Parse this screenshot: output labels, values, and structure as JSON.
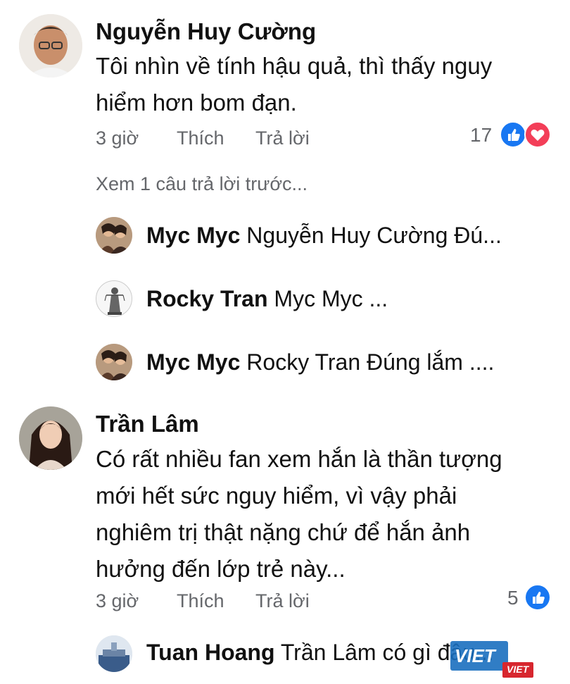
{
  "comments": [
    {
      "author": "Nguyễn Huy Cường",
      "lines": [
        "Tôi nhìn về tính hậu quả, thì thấy nguy",
        "hiểm hơn bom đạn."
      ],
      "time": "3 giờ",
      "like_label": "Thích",
      "reply_label": "Trả lời",
      "reaction_count": "17",
      "reactions": [
        "like-icon",
        "love-icon"
      ]
    },
    {
      "author": "Trần Lâm",
      "lines": [
        "Có rất nhiều fan xem hắn là thần tượng",
        "mới hết sức nguy hiểm, vì vậy phải",
        "nghiêm trị thật nặng chứ để hắn ảnh",
        "hưởng đến lớp trẻ này..."
      ],
      "time": "3 giờ",
      "like_label": "Thích",
      "reply_label": "Trả lời",
      "reaction_count": "5",
      "reactions": [
        "like-icon"
      ]
    }
  ],
  "view_previous_replies": "Xem 1 câu trả lời trước...",
  "replies": [
    {
      "author": "Myc Myc",
      "preview": "Nguyễn Huy Cường  Đú..."
    },
    {
      "author": "Rocky Tran",
      "preview": "Myc Myc ..."
    },
    {
      "author": "Myc Myc",
      "preview": "Rocky Tran  Đúng lắm ...."
    },
    {
      "author": "Tuan Hoang",
      "preview": "Trần Lâm có gì đâu..."
    }
  ],
  "watermark": {
    "text": "VIET",
    "subtext": "VIET"
  },
  "colors": {
    "like": "#1877f2",
    "love": "#f33e58",
    "meta": "#65676b"
  }
}
